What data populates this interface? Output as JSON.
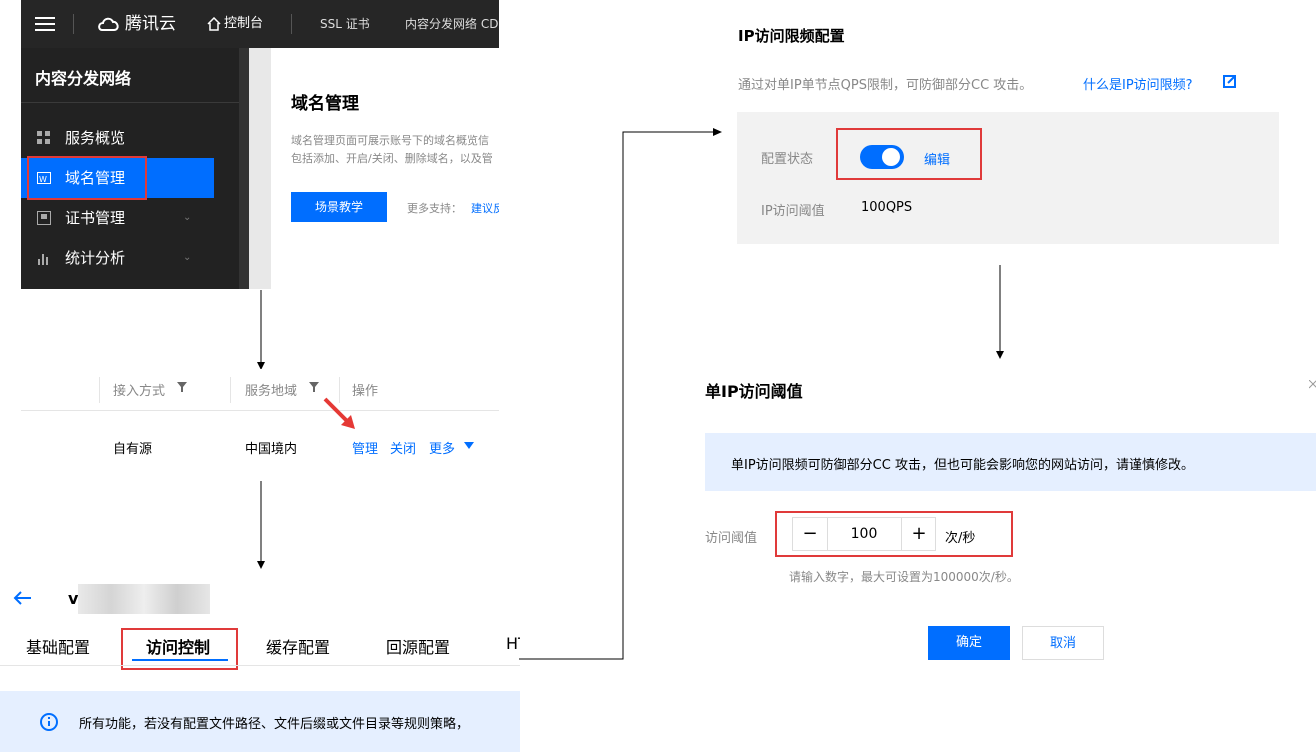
{
  "console": {
    "brand": "腾讯云",
    "nav_console": "控制台",
    "nav_ssl": "SSL 证书",
    "nav_cdn": "内容分发网络 CDN",
    "product": "内容分发网络",
    "sidebar": [
      {
        "label": "服务概览",
        "icon": "grid-icon"
      },
      {
        "label": "域名管理",
        "icon": "domain-icon",
        "active": true
      },
      {
        "label": "证书管理",
        "icon": "cert-icon",
        "chevron": true
      },
      {
        "label": "统计分析",
        "icon": "chart-icon",
        "chevron": true
      }
    ],
    "page_title": "域名管理",
    "desc_line1": "域名管理页面可展示账号下的域名概览信",
    "desc_line2": "包括添加、开启/关闭、删除域名，以及管",
    "tutorial_button": "场景教学",
    "support_label": "更多支持：",
    "feedback_link": "建议反馈"
  },
  "table": {
    "headers": [
      "接入方式",
      "服务地域",
      "操作"
    ],
    "row": {
      "access": "自有源",
      "region": "中国境内"
    },
    "actions": [
      "管理",
      "关闭",
      "更多"
    ]
  },
  "detail": {
    "domain_prefix": "v",
    "tabs": [
      "基础配置",
      "访问控制",
      "缓存配置",
      "回源配置",
      "HTTPS"
    ],
    "active_tab": "访问控制",
    "notice": "所有功能，若没有配置文件路径、文件后缀或文件目录等规则策略，"
  },
  "ip_config": {
    "title": "IP访问限频配置",
    "desc": "通过对单IP单节点QPS限制，可防御部分CC 攻击。",
    "help_link": "什么是IP访问限频?",
    "status_label": "配置状态",
    "edit_link": "编辑",
    "toggle_on": true,
    "threshold_label": "IP访问阈值",
    "threshold_value": "100QPS"
  },
  "dialog": {
    "title": "单IP访问阈值",
    "warning": "单IP访问限频可防御部分CC 攻击，但也可能会影响您的网站访问，请谨慎修改。",
    "field_label": "访问阈值",
    "minus": "−",
    "value": "100",
    "plus": "+",
    "unit": "次/秒",
    "hint": "请输入数字，最大可设置为100000次/秒。",
    "confirm": "确定",
    "cancel": "取消"
  },
  "colors": {
    "accent": "#006eff",
    "highlight": "#e03a3a",
    "dark": "#262626"
  }
}
